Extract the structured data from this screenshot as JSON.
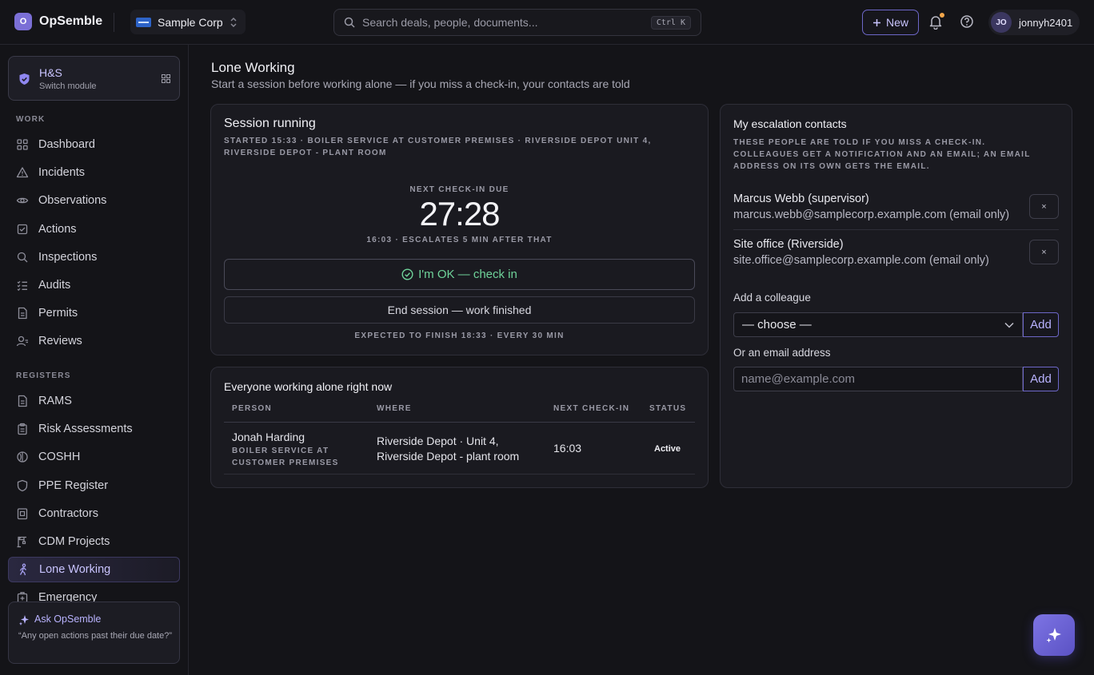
{
  "app": {
    "logo_letter": "O",
    "name": "OpSemble"
  },
  "org": {
    "name": "Sample Corp"
  },
  "search": {
    "placeholder": "Search deals, people, documents...",
    "shortcut": "Ctrl K"
  },
  "header": {
    "new_label": "New",
    "user_initials": "JO",
    "user_name": "jonnyh2401"
  },
  "module": {
    "title": "H&S",
    "subtitle": "Switch module"
  },
  "sidebar": {
    "work_label": "WORK",
    "work_items": [
      {
        "label": "Dashboard",
        "icon": "grid-icon"
      },
      {
        "label": "Incidents",
        "icon": "warning-triangle-icon"
      },
      {
        "label": "Observations",
        "icon": "eye-icon"
      },
      {
        "label": "Actions",
        "icon": "checkbox-icon"
      },
      {
        "label": "Inspections",
        "icon": "magnifier-icon"
      },
      {
        "label": "Audits",
        "icon": "list-check-icon"
      },
      {
        "label": "Permits",
        "icon": "document-icon"
      },
      {
        "label": "Reviews",
        "icon": "person-review-icon"
      }
    ],
    "registers_label": "REGISTERS",
    "register_items": [
      {
        "label": "RAMS",
        "icon": "document-icon"
      },
      {
        "label": "Risk Assessments",
        "icon": "clipboard-icon"
      },
      {
        "label": "COSHH",
        "icon": "flask-icon"
      },
      {
        "label": "PPE Register",
        "icon": "shield-icon"
      },
      {
        "label": "Contractors",
        "icon": "id-card-icon"
      },
      {
        "label": "CDM Projects",
        "icon": "crane-icon"
      },
      {
        "label": "Lone Working",
        "icon": "walking-person-icon",
        "active": true
      },
      {
        "label": "Emergency",
        "icon": "first-aid-icon"
      }
    ]
  },
  "ask": {
    "title": "Ask OpSemble",
    "prompt": "“Any open actions past their due date?”"
  },
  "page": {
    "title": "Lone Working",
    "subtitle": "Start a session before working alone — if you miss a check-in, your contacts are told"
  },
  "session": {
    "title": "Session running",
    "meta": "STARTED 15:33 · BOILER SERVICE AT CUSTOMER PREMISES · RIVERSIDE DEPOT UNIT 4, RIVERSIDE DEPOT - PLANT ROOM",
    "due_label": "NEXT CHECK-IN DUE",
    "timer": "27:28",
    "escalation": "16:03 · ESCALATES 5 MIN AFTER THAT",
    "ok_label": "I'm OK — check in",
    "end_label": "End session — work finished",
    "expected": "EXPECTED TO FINISH 18:33 · EVERY 30 MIN"
  },
  "alone": {
    "title": "Everyone working alone right now",
    "columns": [
      "PERSON",
      "WHERE",
      "NEXT CHECK-IN",
      "STATUS"
    ],
    "rows": [
      {
        "person": "Jonah Harding",
        "task": "BOILER SERVICE AT CUSTOMER PREMISES",
        "where": "Riverside Depot · Unit 4, Riverside Depot - plant room",
        "next_check_in": "16:03",
        "status": "Active"
      }
    ]
  },
  "contacts": {
    "title": "My escalation contacts",
    "description": "THESE PEOPLE ARE TOLD IF YOU MISS A CHECK-IN. COLLEAGUES GET A NOTIFICATION AND AN EMAIL; AN EMAIL ADDRESS ON ITS OWN GETS THE EMAIL.",
    "list": [
      {
        "name": "Marcus Webb (supervisor)",
        "email": "marcus.webb@samplecorp.example.com (email only)"
      },
      {
        "name": "Site office (Riverside)",
        "email": "site.office@samplecorp.example.com (email only)"
      }
    ],
    "remove_label": "×",
    "add_colleague_label": "Add a colleague",
    "select_value": "— choose —",
    "add_label": "Add",
    "email_label": "Or an email address",
    "email_placeholder": "name@example.com"
  },
  "colors": {
    "accent": "#7b6fd6",
    "ok_green": "#6fd39a",
    "background": "#141418",
    "card": "#1a1a20"
  }
}
